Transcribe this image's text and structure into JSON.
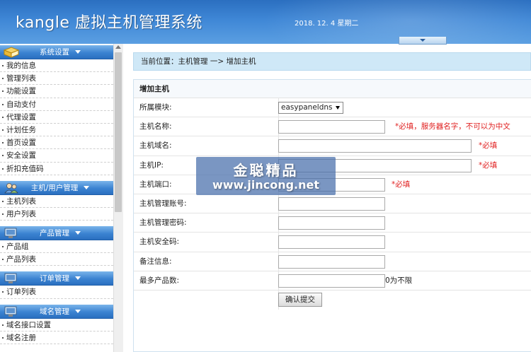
{
  "header": {
    "title": "kangle 虚拟主机管理系统",
    "date": "2018. 12. 4  星期二"
  },
  "sidebar": {
    "groups": [
      {
        "title": "系统设置",
        "icon": "book-icon",
        "items": [
          "我的信息",
          "管理列表",
          "功能设置",
          "自动支付",
          "代理设置",
          "计划任务",
          "首页设置",
          "安全设置",
          "折扣充值码"
        ]
      },
      {
        "title": "主机/用户管理",
        "icon": "users-icon",
        "items": [
          "主机列表",
          "用户列表"
        ]
      },
      {
        "title": "产品管理",
        "icon": "monitor-icon",
        "items": [
          "产品组",
          "产品列表"
        ]
      },
      {
        "title": "订单管理",
        "icon": "monitor-icon",
        "items": [
          "订单列表"
        ]
      },
      {
        "title": "域名管理",
        "icon": "monitor-icon",
        "items": [
          "域名接口设置",
          "域名注册"
        ]
      }
    ]
  },
  "breadcrumb": "当前位置：主机管理 一> 增加主机",
  "form": {
    "title": "增加主机",
    "module_label": "所属模块:",
    "module_value": "easypaneldns",
    "name_label": "主机名称:",
    "name_hint": "*必填，服务器名字，不可以为中文",
    "domain_label": "主机域名:",
    "domain_hint": "*必填",
    "ip_label": "主机IP:",
    "ip_hint": "*必填",
    "port_label": "主机端口:",
    "port_hint": "*必填",
    "account_label": "主机管理账号:",
    "password_label": "主机管理密码:",
    "security_label": "主机安全码:",
    "note_label": "备注信息:",
    "max_label": "最多产品数:",
    "max_suffix": "0为不限",
    "submit_label": "确认提交"
  },
  "watermark": {
    "cn": "金聪精品",
    "en": "www.jincong.net"
  }
}
